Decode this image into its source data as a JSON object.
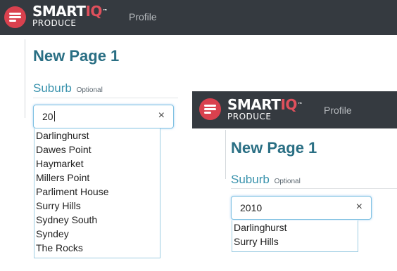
{
  "views": [
    {
      "brand": {
        "name": "SMART",
        "name_highlight": "IQ",
        "trademark": "™",
        "product": "PRODUCE"
      },
      "nav": {
        "profile": "Profile"
      },
      "page_title": "New Page 1",
      "field": {
        "label": "Suburb",
        "optional": "Optional",
        "value": "20",
        "clear_icon": "×"
      },
      "suggestions": [
        "Darlinghurst",
        "Dawes Point",
        "Haymarket",
        "Millers Point",
        "Parliment House",
        "Surry Hills",
        "Sydney South",
        "Syndey",
        "The Rocks"
      ]
    },
    {
      "brand": {
        "name": "SMART",
        "name_highlight": "IQ",
        "trademark": "™",
        "product": "PRODUCE"
      },
      "nav": {
        "profile": "Profile"
      },
      "page_title": "New Page 1",
      "field": {
        "label": "Suburb",
        "optional": "Optional",
        "value": "2010",
        "clear_icon": "×"
      },
      "suggestions": [
        "Darlinghurst",
        "Surry Hills"
      ]
    }
  ]
}
